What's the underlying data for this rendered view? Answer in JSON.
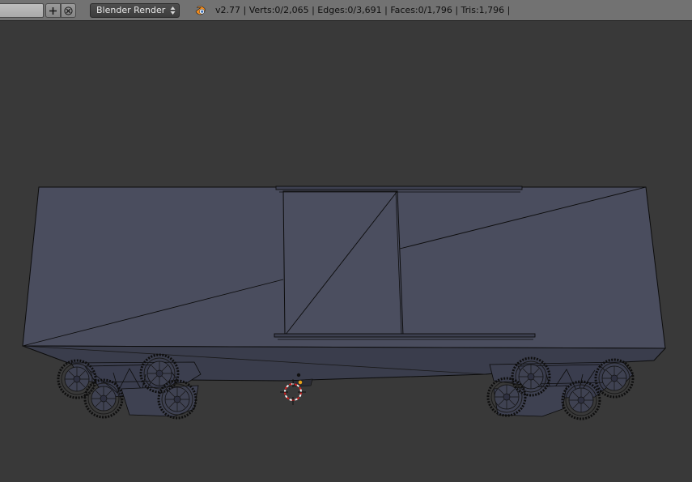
{
  "header": {
    "scene_value": "",
    "render_engine": "Blender Render",
    "stats": "v2.77 | Verts:0/2,065 | Edges:0/3,691 | Faces:0/1,796 | Tris:1,796 |"
  },
  "icons": {
    "add": "plus-icon",
    "close": "x-icon",
    "dropdown": "updown-arrows-icon",
    "logo": "blender-logo-icon",
    "cursor": "3d-cursor-icon"
  },
  "colors": {
    "header_bg": "#727272",
    "viewport_bg": "#393939",
    "mesh_face": "#4a4d5e",
    "mesh_edge": "#0c0c0c",
    "cursor_red": "#d02020"
  }
}
